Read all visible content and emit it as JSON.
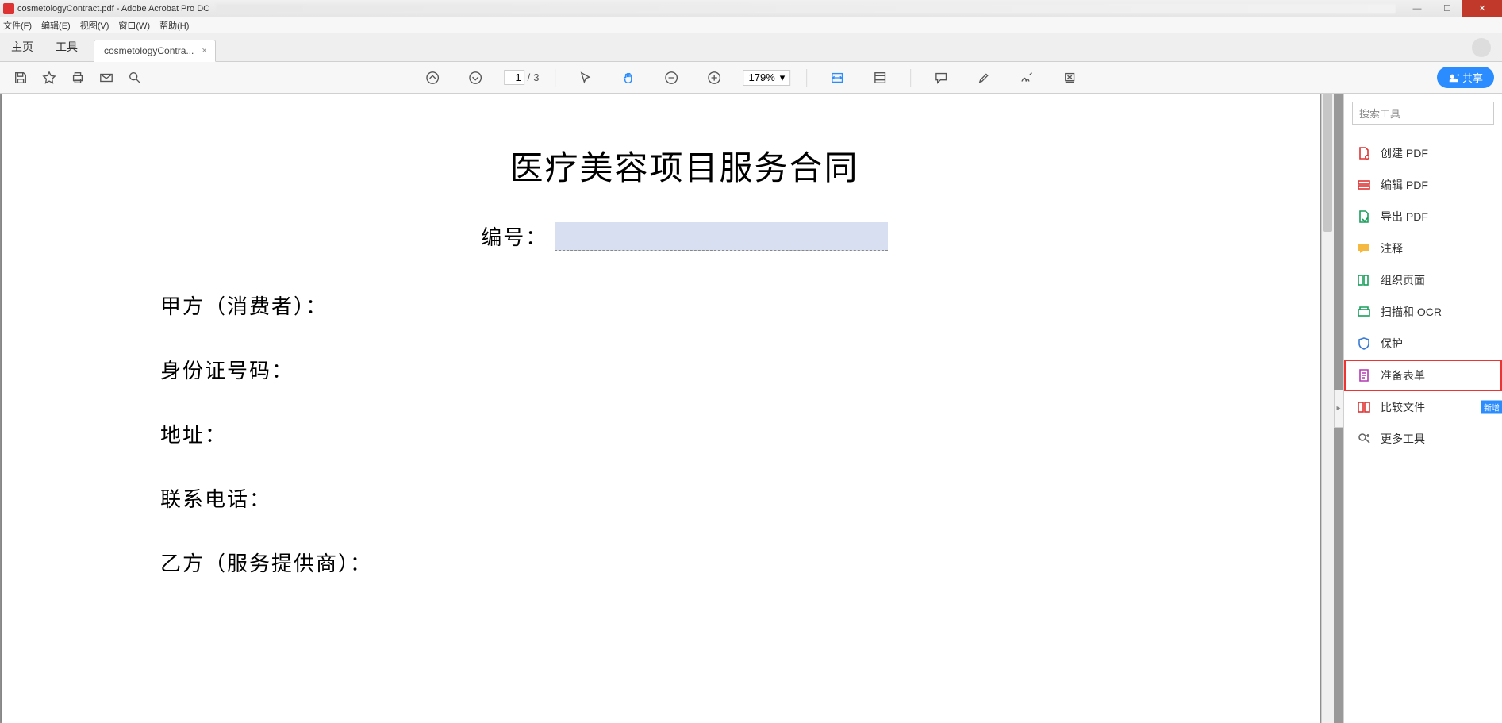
{
  "window": {
    "title": "cosmetologyContract.pdf - Adobe Acrobat Pro DC"
  },
  "menus": {
    "file": "文件(F)",
    "edit": "编辑(E)",
    "view": "视图(V)",
    "window": "窗口(W)",
    "help": "帮助(H)"
  },
  "tabs": {
    "home": "主页",
    "tools": "工具",
    "doc": "cosmetologyContra...",
    "close": "×"
  },
  "toolbar": {
    "page_current": "1",
    "page_sep": "/",
    "page_total": "3",
    "zoom": "179%",
    "zoom_caret": "▾",
    "share": "共享"
  },
  "doc": {
    "title": "医疗美容项目服务合同",
    "ref_label": "编号：",
    "party_a": "甲方（消费者）：",
    "id_no": "身份证号码：",
    "address": "地址：",
    "phone": "联系电话：",
    "party_b": "乙方（服务提供商）："
  },
  "right": {
    "search_placeholder": "搜索工具",
    "create": "创建 PDF",
    "edit": "编辑 PDF",
    "export": "导出 PDF",
    "comment": "注释",
    "organize": "组织页面",
    "scan": "扫描和 OCR",
    "protect": "保护",
    "form": "准备表单",
    "compare": "比较文件",
    "more": "更多工具",
    "badge": "新增"
  }
}
